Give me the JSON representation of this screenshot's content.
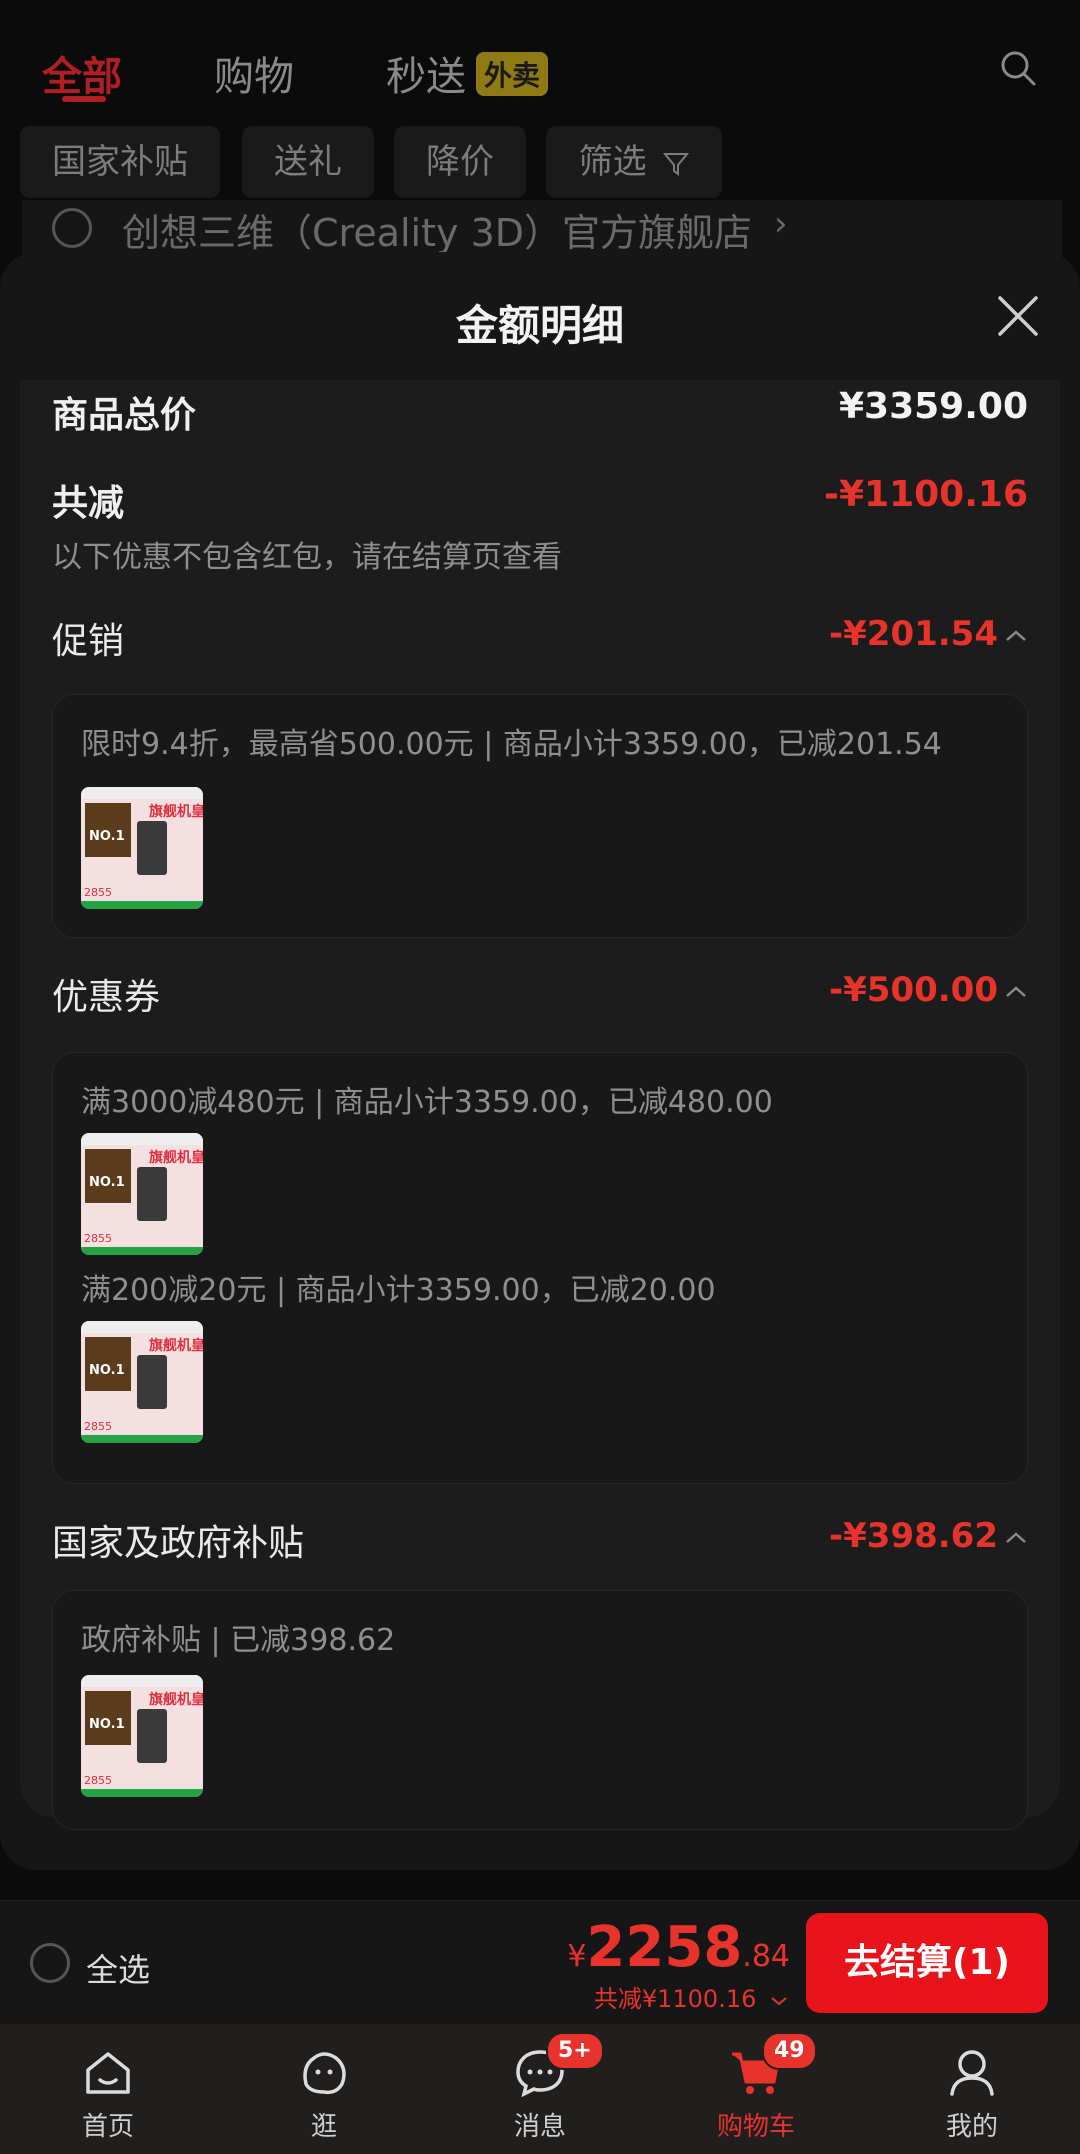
{
  "top_tabs": [
    {
      "label": "全部"
    },
    {
      "label": "购物"
    },
    {
      "label": "秒送"
    }
  ],
  "waimai_badge": "外卖",
  "filter_chips": [
    "国家补贴",
    "送礼",
    "降价",
    "筛选"
  ],
  "store_name": "创想三维（Creality 3D）官方旗舰店",
  "sheet": {
    "title": "金额明细",
    "total_label": "商品总价",
    "total_value": "¥3359.00",
    "reduce_label": "共减",
    "reduce_value": "-¥1100.16",
    "note": "以下优惠不包含红包，请在结算页查看",
    "sections": [
      {
        "title": "促销",
        "amount": "-¥201.54",
        "details": [
          "限时9.4折，最高省500.00元 | 商品小计3359.00，已减201.54"
        ]
      },
      {
        "title": "优惠券",
        "amount": "-¥500.00",
        "details": [
          "满3000减480元 | 商品小计3359.00，已减480.00",
          "满200减20元 | 商品小计3359.00，已减20.00"
        ]
      },
      {
        "title": "国家及政府补贴",
        "amount": "-¥398.62",
        "details": [
          "政府补贴 | 已减398.62"
        ]
      }
    ],
    "thumb": {
      "badge": "NO.1",
      "label": "旗舰机皇",
      "price": "2855"
    }
  },
  "checkout": {
    "select_all": "全选",
    "price_yen": "¥",
    "price_int": "2258",
    "price_dec": ".84",
    "reduce_sub": "共减¥1100.16",
    "button": "去结算(1)"
  },
  "nav": [
    {
      "label": "首页",
      "icon": "home-icon"
    },
    {
      "label": "逛",
      "icon": "face-icon"
    },
    {
      "label": "消息",
      "icon": "chat-icon",
      "badge": "5+"
    },
    {
      "label": "购物车",
      "icon": "cart-icon",
      "badge": "49"
    },
    {
      "label": "我的",
      "icon": "user-icon"
    }
  ],
  "colors": {
    "accent": "#e8332d",
    "button": "#e9131c",
    "tab_active": "#b01f22"
  }
}
